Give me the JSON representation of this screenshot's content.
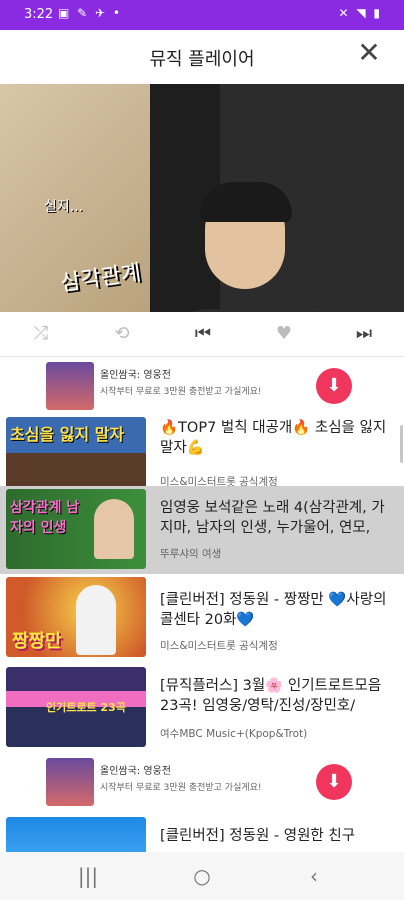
{
  "status_bar": {
    "time": "3:22",
    "left_icons": "▣ ✎ ✈ •",
    "right_icons": "✕ ◥ ▮"
  },
  "header": {
    "title": "뮤직 플레이어",
    "close_icon": "close-icon"
  },
  "player": {
    "caption_small": "실지...",
    "caption_large": "삼각관계",
    "controls": [
      "shuffle-icon",
      "repeat-icon",
      "previous-icon",
      "heart-icon",
      "next-icon"
    ]
  },
  "ad_banner": {
    "title": "올인쌈국: 영웅전",
    "subtitle": "시작부터 무료로 3만원 충전받고 가실게요!"
  },
  "playlist": [
    {
      "title": "🔥TOP7 벌칙 대공개🔥 초심을 잃지 말자💪",
      "channel": "미스&미스터트롯 공식계정",
      "thumb_text": "초심을 잃지 말자"
    },
    {
      "title": "임영웅 보석같은 노래 4(삼각관계, 가지마, 남자의 인생, 누가울어, 연모,",
      "channel": "뚜루샤의 여생",
      "thumb_text": "삼각관계 남자의 인생"
    },
    {
      "title": "[클린버전] 정동원 - 짱짱만 💙사랑의 콜센타 20화💙",
      "channel": "미스&미스터트롯 공식계정",
      "thumb_text": "짱짱만"
    },
    {
      "title": "[뮤직플러스] 3월🌸 인기트로트모음 23곡! 임영웅/영탁/진성/장민호/",
      "channel": "여수MBC Music+(Kpop&Trot)",
      "thumb_text": "인기트로트 23곡"
    },
    {
      "title": "[클린버전] 정동원 - 영원한 친구",
      "channel": "",
      "thumb_text": ""
    }
  ],
  "colors": {
    "status_bar": "#8a2be2",
    "download_button": "#f0365c",
    "selected_row": "#d0d0d0"
  },
  "nav": {
    "recent": "|||",
    "home": "○",
    "back": "‹"
  }
}
